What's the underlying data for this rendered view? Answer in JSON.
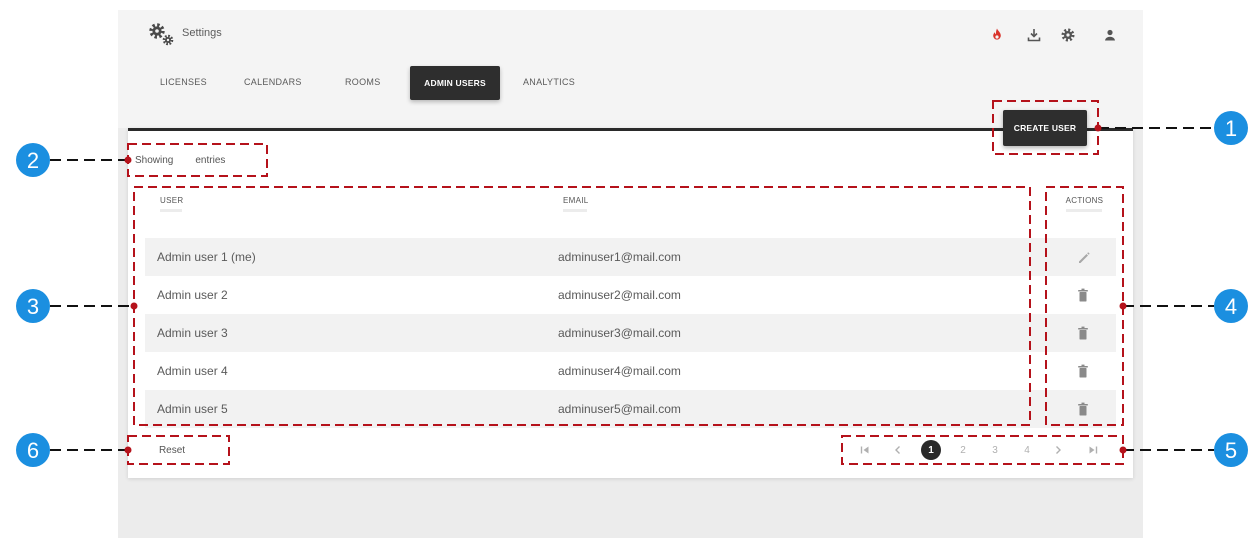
{
  "app": {
    "title": "Settings",
    "logo_icon": "gears-icon"
  },
  "toolbar_icons": [
    {
      "icon": "alert-icon",
      "color": "#d9342b"
    },
    {
      "icon": "download-icon",
      "color": "#555555"
    },
    {
      "icon": "gear-icon",
      "color": "#555555"
    },
    {
      "icon": "user-icon",
      "color": "#555555"
    }
  ],
  "tabs": [
    {
      "label": "LICENSES",
      "active": false
    },
    {
      "label": "CALENDARS",
      "active": false
    },
    {
      "label": "ROOMS",
      "active": false
    },
    {
      "label": "ADMIN USERS",
      "active": true
    },
    {
      "label": "ANALYTICS",
      "active": false
    }
  ],
  "create_user_button": {
    "label": "CREATE USER"
  },
  "entries": {
    "prefix": "Showing",
    "suffix": "entries"
  },
  "table": {
    "columns": {
      "user": "USER",
      "email": "EMAIL",
      "actions": "ACTIONS"
    },
    "rows": [
      {
        "user": "Admin user 1 (me)",
        "email": "adminuser1@mail.com",
        "action_icon": "edit-icon"
      },
      {
        "user": "Admin user 2",
        "email": "adminuser2@mail.com",
        "action_icon": "delete-icon"
      },
      {
        "user": "Admin user 3",
        "email": "adminuser3@mail.com",
        "action_icon": "delete-icon"
      },
      {
        "user": "Admin user 4",
        "email": "adminuser4@mail.com",
        "action_icon": "delete-icon"
      },
      {
        "user": "Admin user 5",
        "email": "adminuser5@mail.com",
        "action_icon": "delete-icon"
      }
    ]
  },
  "reset_button": {
    "label": "Reset"
  },
  "pagination": {
    "first_icon": "first-page-icon",
    "prev_icon": "prev-page-icon",
    "pages": [
      "1",
      "2",
      "3",
      "4"
    ],
    "current_page": "1",
    "next_icon": "next-page-icon",
    "last_icon": "last-page-icon"
  },
  "annotations": {
    "box_color": "#b5121b",
    "badge_color": "#1b8fe0",
    "labels": [
      "1",
      "2",
      "3",
      "4",
      "5",
      "6"
    ]
  }
}
